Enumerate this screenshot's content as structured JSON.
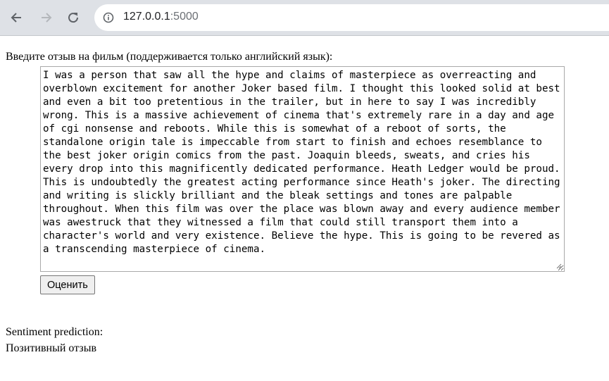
{
  "browser": {
    "url_host": "127.0.0.1",
    "url_port": ":5000"
  },
  "form": {
    "prompt_label": "Введите отзыв на фильм (поддерживается только английский язык):",
    "review_text": "I was a person that saw all the hype and claims of masterpiece as overreacting and overblown excitement for another Joker based film. I thought this looked solid at best and even a bit too pretentious in the trailer, but in here to say I was incredibly wrong. This is a massive achievement of cinema that's extremely rare in a day and age of cgi nonsense and reboots. While this is somewhat of a reboot of sorts, the standalone origin tale is impeccable from start to finish and echoes resemblance to the best joker origin comics from the past. Joaquin bleeds, sweats, and cries his every drop into this magnificently dedicated performance. Heath Ledger would be proud. This is undoubtedly the greatest acting performance since Heath's joker. The directing and writing is slickly brilliant and the bleak settings and tones are palpable throughout. When this film was over the place was blown away and every audience member was awestruck that they witnessed a film that could still transport them into a character's world and very existence. Believe the hype. This is going to be revered as a transcending masterpiece of cinema.",
    "submit_label": "Оценить"
  },
  "result": {
    "heading": "Sentiment prediction:",
    "value": "Позитивный отзыв"
  },
  "icons": {
    "back": "back-arrow-icon",
    "forward": "forward-arrow-icon",
    "reload": "reload-icon",
    "info": "info-icon"
  }
}
